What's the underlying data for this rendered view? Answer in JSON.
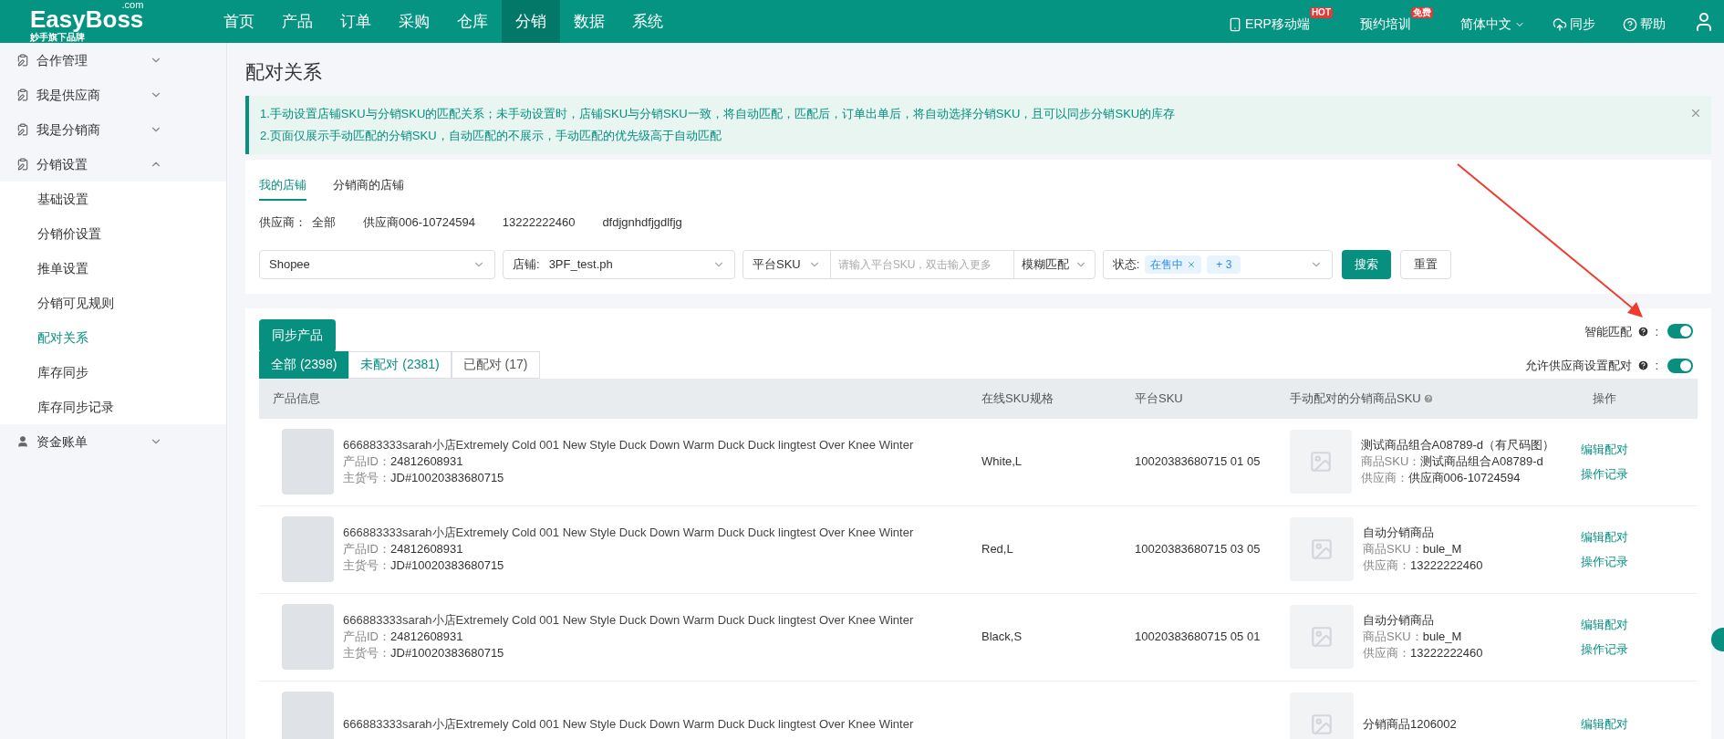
{
  "header": {
    "logo": {
      "name": "EasyBoss",
      "suffix": ".com",
      "tagline": "妙手旗下品牌"
    },
    "nav": [
      {
        "label": "首页",
        "selected": false
      },
      {
        "label": "产品",
        "selected": false
      },
      {
        "label": "订单",
        "selected": false
      },
      {
        "label": "采购",
        "selected": false
      },
      {
        "label": "仓库",
        "selected": false
      },
      {
        "label": "分销",
        "selected": true
      },
      {
        "label": "数据",
        "selected": false
      },
      {
        "label": "系统",
        "selected": false
      }
    ],
    "tools": [
      {
        "kind": "mobile",
        "label": "ERP移动端",
        "badge": "HOT"
      },
      {
        "kind": "plain",
        "label": "预约培训",
        "badge": "免费"
      },
      {
        "kind": "dropdown",
        "label": "简体中文"
      },
      {
        "kind": "cloud",
        "label": "同步"
      },
      {
        "kind": "help",
        "label": "帮助"
      }
    ]
  },
  "sidebar": [
    {
      "label": "合作管理",
      "kind": "clipboard",
      "expanded": false
    },
    {
      "label": "我是供应商",
      "kind": "clipboard",
      "expanded": false
    },
    {
      "label": "我是分销商",
      "kind": "clipboard",
      "expanded": false
    },
    {
      "label": "分销设置",
      "kind": "clipboard",
      "expanded": true,
      "children": [
        {
          "label": "基础设置",
          "selected": false
        },
        {
          "label": "分销价设置",
          "selected": false
        },
        {
          "label": "推单设置",
          "selected": false
        },
        {
          "label": "分销可见规则",
          "selected": false
        },
        {
          "label": "配对关系",
          "selected": true
        },
        {
          "label": "库存同步",
          "selected": false
        },
        {
          "label": "库存同步记录",
          "selected": false
        }
      ]
    },
    {
      "label": "资金账单",
      "kind": "user",
      "expanded": false
    }
  ],
  "page_title": "配对关系",
  "notice": [
    "1.手动设置店铺SKU与分销SKU的匹配关系；未手动设置时，店铺SKU与分销SKU一致，将自动匹配，匹配后，订单出单后，将自动选择分销SKU，且可以同步分销SKU的库存",
    "2.页面仅展示手动匹配的分销SKU，自动匹配的不展示，手动匹配的优先级高于自动匹配"
  ],
  "store_tabs": [
    {
      "label": "我的店铺",
      "selected": true
    },
    {
      "label": "分销商的店铺",
      "selected": false
    }
  ],
  "supplier_filter": {
    "label": "供应商：",
    "options": [
      "全部",
      "供应商006-10724594",
      "13222222460",
      "dfdjgnhdfjgdlfjg"
    ]
  },
  "filters": {
    "platform": "Shopee",
    "store": {
      "label": "店铺:",
      "value": "3PF_test.ph"
    },
    "sku": {
      "type": "平台SKU",
      "placeholder": "请输入平台SKU，双击输入更多",
      "match": "模糊匹配"
    },
    "status": {
      "label": "状态:",
      "tags": [
        "在售中"
      ],
      "more": "+ 3"
    },
    "search": "搜索",
    "reset": "重置"
  },
  "sync_button": "同步产品",
  "toggles": [
    {
      "label": "智能匹配",
      "colon": ":",
      "on": true
    },
    {
      "label": "允许供应商设置配对",
      "colon": ":",
      "on": true
    }
  ],
  "tabs": [
    {
      "label": "全部 (2398)",
      "selected": true,
      "highlighted": false
    },
    {
      "label": "未配对 (2381)",
      "selected": false,
      "highlighted": true
    },
    {
      "label": "已配对 (17)",
      "selected": false,
      "highlighted": false
    }
  ],
  "columns": [
    {
      "label": "产品信息",
      "help": false
    },
    {
      "label": "在线SKU规格",
      "help": false
    },
    {
      "label": "平台SKU",
      "help": false
    },
    {
      "label": "手动配对的分销商品SKU",
      "help": true
    },
    {
      "label": "操作",
      "help": false
    }
  ],
  "rows": [
    {
      "title": "666883333sarah小店Extremely Cold 001 New Style Duck Down Warm Duck Duck lingtest Over Knee Winter",
      "id_label": "产品ID：",
      "id": "24812608931",
      "code_label": "主货号：",
      "code": "JD#10020383680715",
      "spec": "White,L",
      "platform_sku": "10020383680715 01 05",
      "match_name": "测试商品组合A08789-d（有尺码图）",
      "match_sku_label": "商品SKU：",
      "match_sku": "测试商品组合A08789-d",
      "supplier_label": "供应商：",
      "supplier": "供应商006-10724594",
      "actions": [
        "编辑配对",
        "操作记录"
      ]
    },
    {
      "title": "666883333sarah小店Extremely Cold 001 New Style Duck Down Warm Duck Duck lingtest Over Knee Winter",
      "id_label": "产品ID：",
      "id": "24812608931",
      "code_label": "主货号：",
      "code": "JD#10020383680715",
      "spec": "Red,L",
      "platform_sku": "10020383680715 03 05",
      "match_name": "自动分销商品",
      "match_sku_label": "商品SKU：",
      "match_sku": "bule_M",
      "supplier_label": "供应商：",
      "supplier": "13222222460",
      "actions": [
        "编辑配对",
        "操作记录"
      ]
    },
    {
      "title": "666883333sarah小店Extremely Cold 001 New Style Duck Down Warm Duck Duck lingtest Over Knee Winter",
      "id_label": "产品ID：",
      "id": "24812608931",
      "code_label": "主货号：",
      "code": "JD#10020383680715",
      "spec": "Black,S",
      "platform_sku": "10020383680715 05 01",
      "match_name": "自动分销商品",
      "match_sku_label": "商品SKU：",
      "match_sku": "bule_M",
      "supplier_label": "供应商：",
      "supplier": "13222222460",
      "actions": [
        "编辑配对",
        "操作记录"
      ]
    },
    {
      "title": "666883333sarah小店Extremely Cold 001 New Style Duck Down Warm Duck Duck lingtest Over Knee Winter",
      "match_name": "分销商品1206002",
      "actions": [
        "编辑配对"
      ]
    }
  ]
}
